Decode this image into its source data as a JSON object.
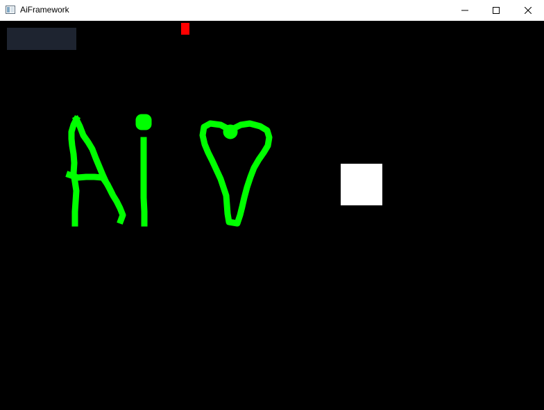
{
  "window": {
    "title": "AiFramework",
    "icon": "app-window-icon",
    "controls": {
      "minimize_icon": "minimize-icon",
      "maximize_icon": "maximize-icon",
      "close_icon": "close-icon"
    }
  },
  "canvas": {
    "background_color": "#000000",
    "panel_color": "#1e2430",
    "marker_color": "#ff0000",
    "square_color": "#ffffff",
    "stroke_color": "#00ff00"
  }
}
